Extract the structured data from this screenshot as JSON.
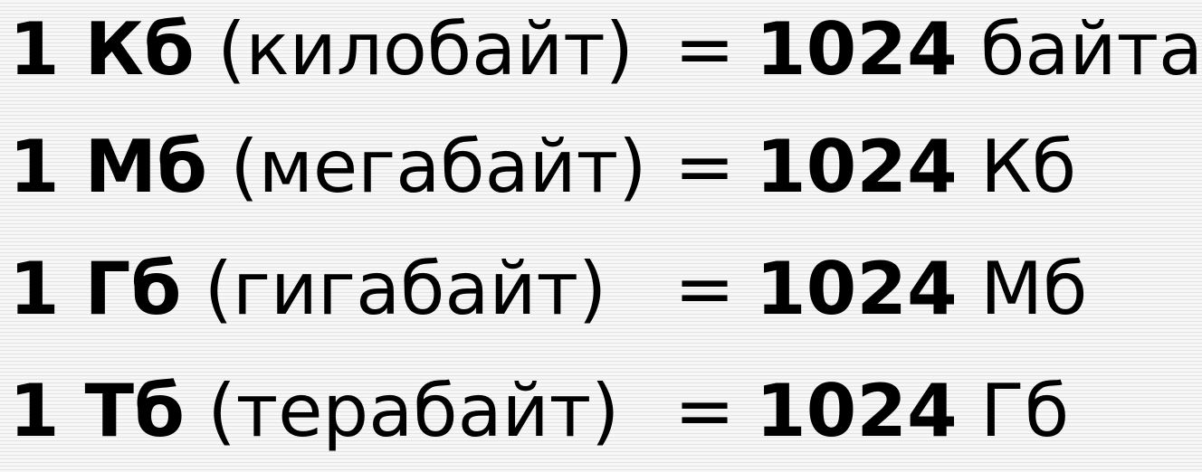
{
  "rows": [
    {
      "abbr": "1 Кб",
      "name": "(килобайт)",
      "equals": "=",
      "number": "1024",
      "target": "байта"
    },
    {
      "abbr": "1 Мб",
      "name": "(мегабайт)",
      "equals": "=",
      "number": "1024",
      "target": "Кб"
    },
    {
      "abbr": "1 Гб",
      "name": "(гигабайт)",
      "equals": "=",
      "number": "1024",
      "target": "Мб"
    },
    {
      "abbr": "1 Тб",
      "name": "(терабайт)",
      "equals": "=",
      "number": "1024",
      "target": "Гб"
    }
  ]
}
